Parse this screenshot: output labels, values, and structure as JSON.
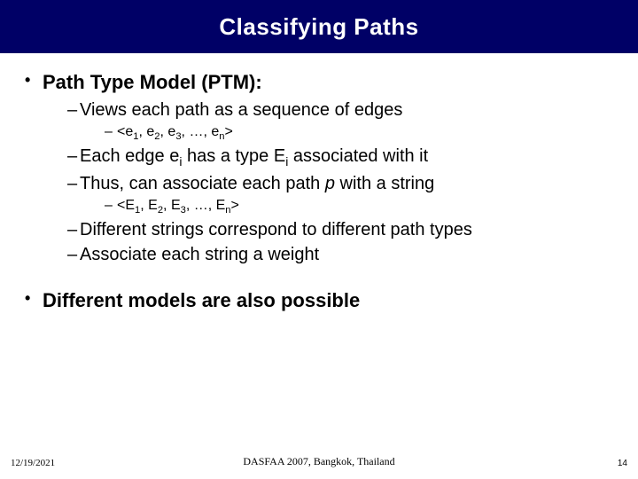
{
  "title": "Classifying Paths",
  "bullets": {
    "b1": "Path Type Model (PTM):",
    "b1_1": "Views each path as a sequence of edges",
    "b1_1_1_html": "&lt;e<sub>1</sub>, e<sub>2</sub>, e<sub>3</sub>, …, e<sub>n</sub>&gt;",
    "b1_2_html": "Each edge e<sub>i</sub> has a type E<sub>i</sub> associated with it",
    "b1_3_html": "Thus, can associate each path <span class=\"italic\">p</span> with a string",
    "b1_3_1_html": "&lt;E<sub>1</sub>, E<sub>2</sub>, E<sub>3</sub>, …, E<sub>n</sub>&gt;",
    "b1_4": "Different strings correspond to different path types",
    "b1_5": "Associate each string a weight",
    "b2": "Different models are also possible"
  },
  "footer": {
    "date": "12/19/2021",
    "center": "DASFAA 2007, Bangkok, Thailand",
    "page": "14"
  }
}
